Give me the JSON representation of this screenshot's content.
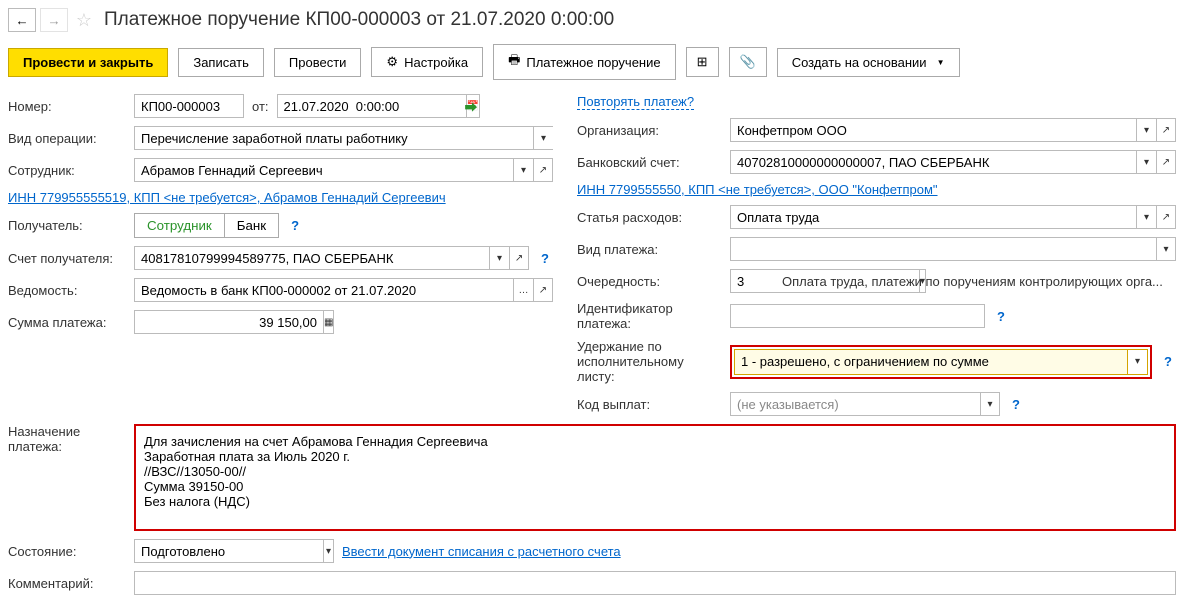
{
  "header": {
    "title": "Платежное поручение КП00-000003 от 21.07.2020 0:00:00"
  },
  "toolbar": {
    "post_close": "Провести и закрыть",
    "save": "Записать",
    "post": "Провести",
    "settings": "Настройка",
    "print": "Платежное поручение",
    "create_based": "Создать на основании"
  },
  "labels": {
    "number": "Номер:",
    "date_from": "от:",
    "operation_type": "Вид операции:",
    "employee": "Сотрудник:",
    "recipient": "Получатель:",
    "recipient_account": "Счет получателя:",
    "statement": "Ведомость:",
    "payment_sum": "Сумма платежа:",
    "organization": "Организация:",
    "bank_account": "Банковский счет:",
    "expense_item": "Статья расходов:",
    "payment_type": "Вид платежа:",
    "priority": "Очередность:",
    "payment_id": "Идентификатор платежа:",
    "retention": "Удержание по исполнительному листу:",
    "payout_code": "Код выплат:",
    "purpose": "Назначение платежа:",
    "state": "Состояние:",
    "comment": "Комментарий:"
  },
  "values": {
    "number": "КП00-000003",
    "date": "21.07.2020  0:00:00",
    "operation_type": "Перечисление заработной платы работнику",
    "employee": "Абрамов Геннадий Сергеевич",
    "inn_link_left": "ИНН 779955555519, КПП <не требуется>, Абрамов Геннадий Сергеевич",
    "recipient_employee": "Сотрудник",
    "recipient_bank": "Банк",
    "recipient_account": "40817810799994589775, ПАО СБЕРБАНК",
    "statement": "Ведомость в банк КП00-000002 от 21.07.2020",
    "payment_sum": "39 150,00",
    "repeat_payment": "Повторять платеж?",
    "organization": "Конфетпром ООО",
    "bank_account": "40702810000000000007, ПАО СБЕРБАНК",
    "inn_link_right": "ИНН 7799555550, КПП <не требуется>, ООО \"Конфетпром\"",
    "expense_item": "Оплата труда",
    "payment_type": "",
    "priority": "3",
    "priority_text": "Оплата труда, платежи по поручениям контролирующих орга...",
    "payment_id": "",
    "retention": "1 - разрешено, с ограничением по сумме",
    "payout_code": "(не указывается)",
    "purpose": "Для зачисления на счет Абрамова Геннадия Сергеевича\nЗаработная плата за Июль 2020 г.\n//ВЗС//13050-00//\nСумма 39150-00\nБез налога (НДС)",
    "state": "Подготовлено",
    "state_link": "Ввести документ списания с расчетного счета",
    "comment": ""
  }
}
